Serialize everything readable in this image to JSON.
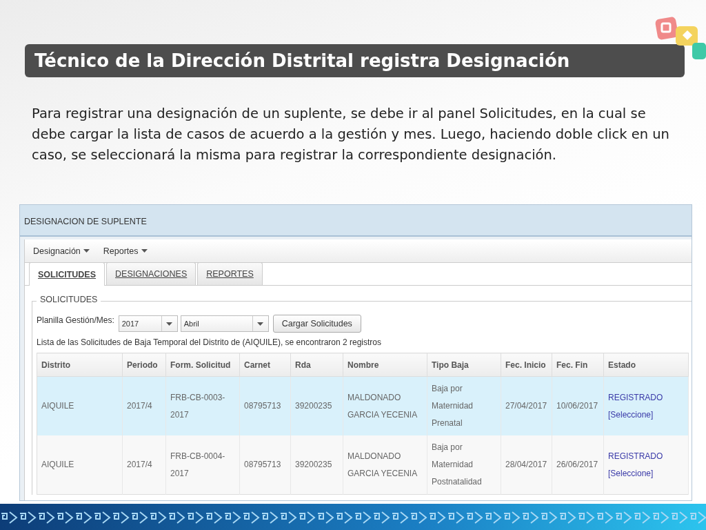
{
  "slide": {
    "title": "Técnico de la Dirección Distrital registra Designación",
    "paragraph": "Para registrar una designación de un suplente, se debe ir al panel Solicitudes, en la cual se debe cargar la lista de casos de acuerdo a la gestión y mes. Luego, haciendo doble click en un caso, se seleccionará la misma para registrar la correspondiente designación."
  },
  "app": {
    "title": "DESIGNACION DE SUPLENTE",
    "menus": [
      "Designación",
      "Reportes"
    ],
    "tabs": [
      {
        "label": "SOLICITUDES",
        "selected": true
      },
      {
        "label": "DESIGNACIONES",
        "selected": false
      },
      {
        "label": "REPORTES",
        "selected": false
      }
    ],
    "fieldset": {
      "legend": "SOLICITUDES",
      "filter_label": "Planilla Gestión/Mes:",
      "year": "2017",
      "month": "Abril",
      "load_button": "Cargar Solicitudes",
      "summary": "Lista de las Solicitudes de Baja Temporal del Distrito de (AIQUILE), se encontraron 2 registros"
    },
    "table": {
      "columns": [
        "Distrito",
        "Periodo",
        "Form. Solicitud",
        "Carnet",
        "Rda",
        "Nombre",
        "Tipo Baja",
        "Fec. Inicio",
        "Fec. Fin",
        "Estado"
      ],
      "rows": [
        {
          "selected": true,
          "cells": [
            "AIQUILE",
            "2017/4",
            "FRB-CB-0003-2017",
            "08795713",
            "39200235",
            "MALDONADO GARCIA YECENIA",
            "Baja por Maternidad Prenatal",
            "27/04/2017",
            "10/06/2017"
          ],
          "status": "REGISTRADO",
          "action": "[Seleccione]"
        },
        {
          "selected": false,
          "cells": [
            "AIQUILE",
            "2017/4",
            "FRB-CB-0004-2017",
            "08795713",
            "39200235",
            "MALDONADO GARCIA YECENIA",
            "Baja por Maternidad Postnatalidad",
            "28/04/2017",
            "26/06/2017"
          ],
          "status": "REGISTRADO",
          "action": "[Seleccione]"
        }
      ]
    }
  }
}
